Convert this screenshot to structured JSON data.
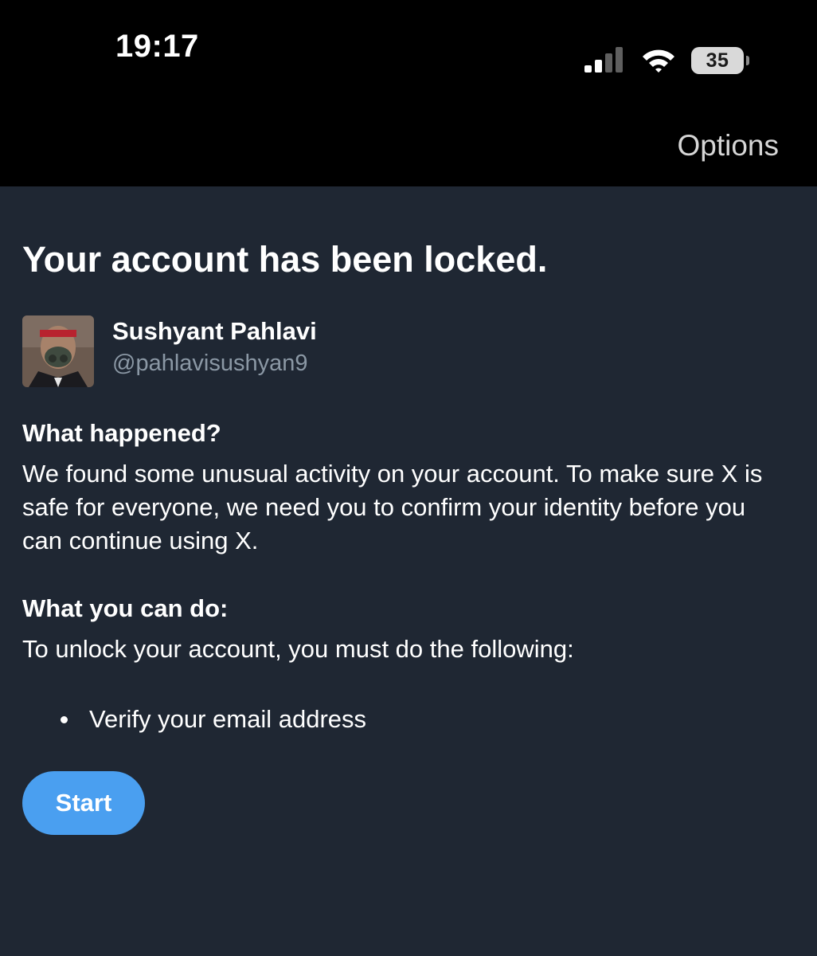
{
  "status_bar": {
    "time": "19:17",
    "battery_level": "35",
    "icons": [
      "cellular-signal-icon",
      "wifi-icon",
      "battery-icon"
    ]
  },
  "header": {
    "options_label": "Options"
  },
  "main": {
    "title": "Your account has been locked.",
    "profile": {
      "name": "Sushyant Pahlavi",
      "handle": "@pahlavisushyan9"
    },
    "what_happened": {
      "heading": "What happened?",
      "text": "We found some unusual activity on your account. To make sure X is safe for everyone, we need you to confirm your identity before you can continue using X."
    },
    "what_you_can_do": {
      "heading": "What you can do:",
      "text": "To unlock your account, you must do the following:",
      "steps": [
        "Verify your email address"
      ]
    },
    "start_label": "Start"
  },
  "colors": {
    "background": "#1f2733",
    "header_background": "#000000",
    "accent": "#4a9ff0",
    "secondary_text": "#8b98a5"
  }
}
